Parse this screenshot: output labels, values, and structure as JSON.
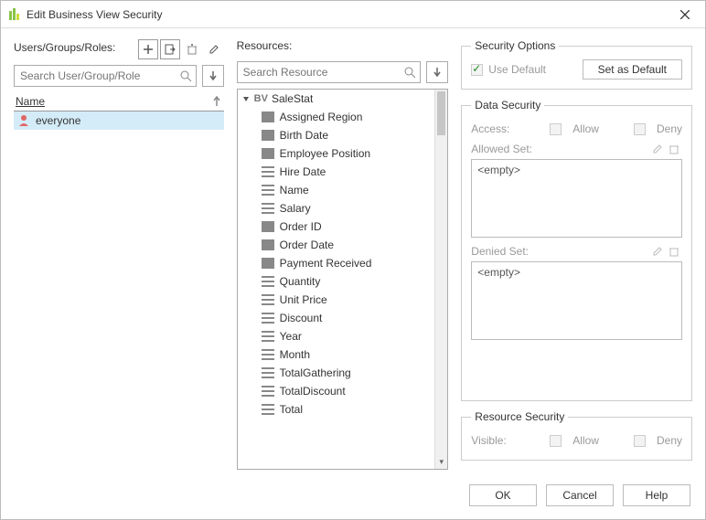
{
  "window": {
    "title": "Edit Business View Security"
  },
  "usersPanel": {
    "label": "Users/Groups/Roles:",
    "searchPlaceholder": "Search User/Group/Role",
    "columnHeader": "Name",
    "rows": [
      {
        "name": "everyone"
      }
    ]
  },
  "resourcesPanel": {
    "label": "Resources:",
    "searchPlaceholder": "Search Resource",
    "rootLabel": "SaleStat",
    "items": [
      {
        "label": "Assigned Region",
        "iconType": "block"
      },
      {
        "label": "Birth Date",
        "iconType": "block"
      },
      {
        "label": "Employee Position",
        "iconType": "block"
      },
      {
        "label": "Hire Date",
        "iconType": "lines"
      },
      {
        "label": "Name",
        "iconType": "lines"
      },
      {
        "label": "Salary",
        "iconType": "lines"
      },
      {
        "label": "Order ID",
        "iconType": "block"
      },
      {
        "label": "Order Date",
        "iconType": "block"
      },
      {
        "label": "Payment Received",
        "iconType": "block"
      },
      {
        "label": "Quantity",
        "iconType": "lines"
      },
      {
        "label": "Unit Price",
        "iconType": "lines"
      },
      {
        "label": "Discount",
        "iconType": "lines"
      },
      {
        "label": "Year",
        "iconType": "lines"
      },
      {
        "label": "Month",
        "iconType": "lines"
      },
      {
        "label": "TotalGathering",
        "iconType": "lines"
      },
      {
        "label": "TotalDiscount",
        "iconType": "lines"
      },
      {
        "label": "Total",
        "iconType": "lines"
      }
    ]
  },
  "securityOptions": {
    "legend": "Security Options",
    "useDefaultLabel": "Use Default",
    "setAsDefaultLabel": "Set as Default"
  },
  "dataSecurity": {
    "legend": "Data Security",
    "accessLabel": "Access:",
    "allowLabel": "Allow",
    "denyLabel": "Deny",
    "allowedSetLabel": "Allowed Set:",
    "deniedSetLabel": "Denied Set:",
    "emptyText": "<empty>"
  },
  "resourceSecurity": {
    "legend": "Resource Security",
    "visibleLabel": "Visible:",
    "allowLabel": "Allow",
    "denyLabel": "Deny"
  },
  "footer": {
    "ok": "OK",
    "cancel": "Cancel",
    "help": "Help"
  }
}
